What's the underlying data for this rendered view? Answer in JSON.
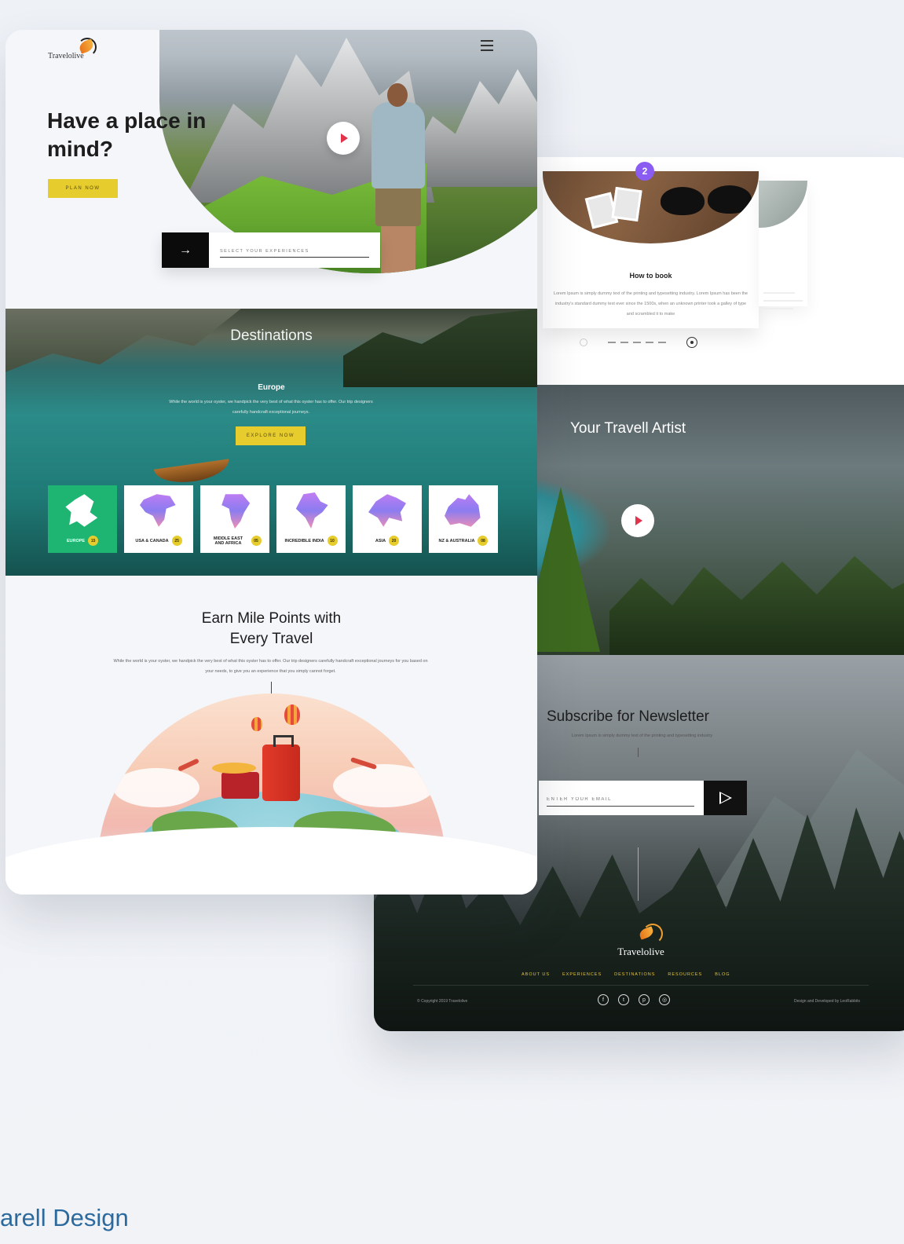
{
  "front": {
    "logo_text": "Travelolive",
    "hero": {
      "title": "Have a place in mind?",
      "plan_button": "PLAN NOW",
      "select_placeholder": "SELECT YOUR EXPERIENCES",
      "arrow": "→"
    },
    "destinations": {
      "title": "Destinations",
      "subtitle": "Europe",
      "text": "While the world is your oyster, we handpick the very best of what this oyster has to offer. Our trip designers carefully handcraft exceptional journeys.",
      "explore_button": "EXPLORE NOW",
      "regions": [
        {
          "label": "EUROPE",
          "count": "15",
          "active": true
        },
        {
          "label": "USA & CANADA",
          "count": "25",
          "active": false
        },
        {
          "label": "MIDDLE EAST AND AFRICA",
          "count": "05",
          "active": false
        },
        {
          "label": "INCREDIBLE INDIA",
          "count": "10",
          "active": false
        },
        {
          "label": "ASIA",
          "count": "20",
          "active": false
        },
        {
          "label": "NZ & AUSTRALIA",
          "count": "08",
          "active": false
        }
      ]
    },
    "earn": {
      "title_line1": "Earn Mile Points with",
      "title_line2": "Every Travel",
      "text": "While the world is your oyster, we handpick the very best of what this oyster has to offer. Our trip designers carefully handcraft exceptional journeys for you based on your needs, to give you an experience that you simply cannot forget."
    }
  },
  "back": {
    "how_to_book": {
      "badge": "2",
      "title": "How to book",
      "text": "Lorem Ipsum is simply dummy text of the printing and typesetting industry. Lorem Ipsum has been the industry's standard dummy text ever since the 1500s, when an unknown printer took a galley of type and scrambled it to make"
    },
    "artist": {
      "title": "Your Travell Artist"
    },
    "newsletter": {
      "title": "Subscribe for Newsletter",
      "subtitle": "Lorem Ipsum is simply dummy text of the printing and typesetting industry",
      "placeholder": "ENTER YOUR EMAIL"
    },
    "footer": {
      "logo_text": "Travelolive",
      "nav": [
        "ABOUT US",
        "EXPERIENCES",
        "DESTINATIONS",
        "RESOURCES",
        "BLOG"
      ],
      "copyright": "© Copyright 2019 Travelolive",
      "social": [
        "f",
        "t",
        "p",
        "◎"
      ],
      "credit": "Design and Developed by LeoRabbits"
    }
  },
  "caption": "arell Design",
  "colors": {
    "accent_yellow": "#e6cc2c",
    "active_green": "#1eb573",
    "play_red": "#e3324b",
    "badge_purple": "#8a5cf2",
    "caption_blue": "#2c6a9e"
  }
}
